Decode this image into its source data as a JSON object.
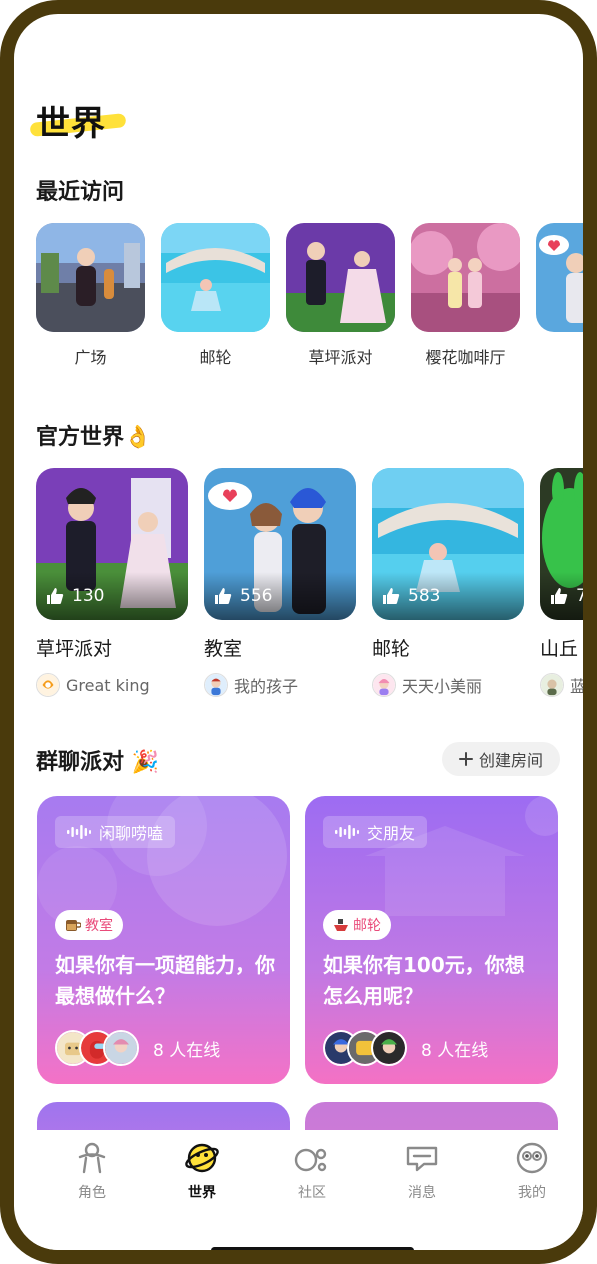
{
  "page": {
    "title": "世界"
  },
  "recent": {
    "title": "最近访问",
    "items": [
      {
        "label": "广场"
      },
      {
        "label": "邮轮"
      },
      {
        "label": "草坪派对"
      },
      {
        "label": "樱花咖啡厅"
      },
      {
        "label": "教"
      }
    ]
  },
  "official": {
    "title": "官方世界👌",
    "items": [
      {
        "name": "草坪派对",
        "likes": "130",
        "author": "Great king"
      },
      {
        "name": "教室",
        "likes": "556",
        "author": "我的孩子"
      },
      {
        "name": "邮轮",
        "likes": "583",
        "author": "天天小美丽"
      },
      {
        "name": "山丘",
        "likes": "7",
        "author": "蓝"
      }
    ]
  },
  "group": {
    "title": "群聊派对 🎉",
    "create_label": "创建房间",
    "cards": [
      {
        "tag": "闲聊唠嗑",
        "location": "教室",
        "question": "如果你有一项超能力，你最想做什么？",
        "online": "8 人在线"
      },
      {
        "tag": "交朋友",
        "location": "邮轮",
        "question": "如果你有100元，你想怎么用呢？",
        "online": "8 人在线"
      }
    ]
  },
  "tabs": [
    {
      "label": "角色",
      "icon": "character-icon"
    },
    {
      "label": "世界",
      "icon": "planet-icon",
      "active": true
    },
    {
      "label": "社区",
      "icon": "community-icon"
    },
    {
      "label": "消息",
      "icon": "message-icon"
    },
    {
      "label": "我的",
      "icon": "profile-icon"
    }
  ],
  "colors": {
    "frame": "#4a3a0c",
    "title_highlight": "#ffe13a",
    "party_purple": "#9b6cf0",
    "party_pink": "#f26fc4",
    "badge_text": "#e94a7a"
  }
}
